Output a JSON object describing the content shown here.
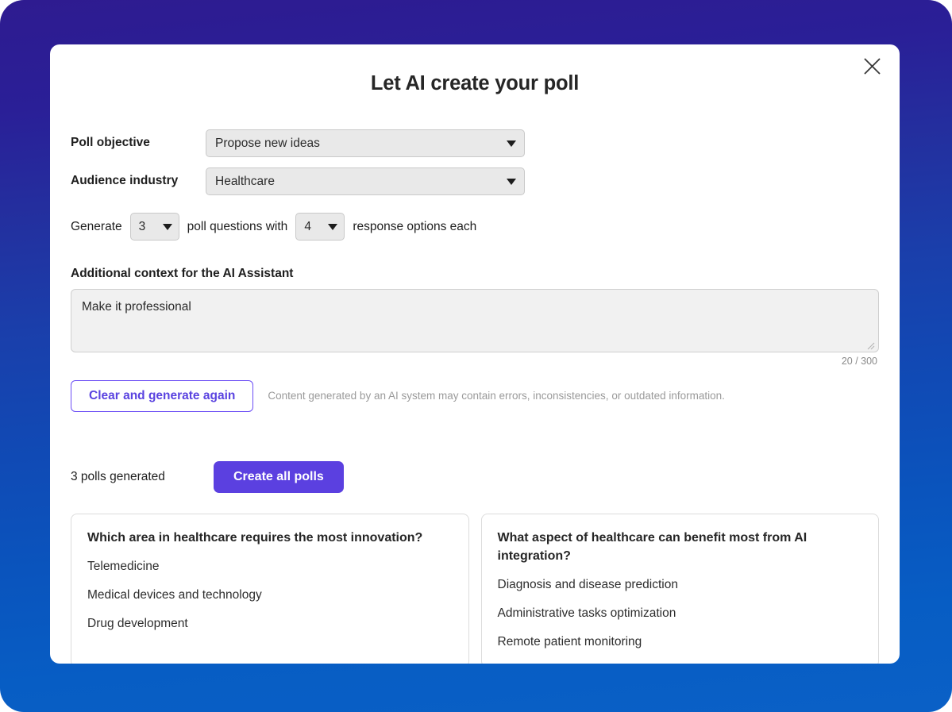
{
  "theme": {
    "gradient_top": "#2e1b90",
    "gradient_bottom": "#0a60c6",
    "accent_primary": "#5b40e0",
    "accent_outline": "#6b4df5",
    "modal_bg": "#ffffff",
    "field_bg": "#e9e9e9",
    "textarea_bg": "#f1f1f1"
  },
  "modal": {
    "title": "Let AI create your poll",
    "close_icon": "close-icon"
  },
  "form": {
    "objective": {
      "label": "Poll objective",
      "value": "Propose new ideas",
      "caret_icon": "chevron-down-icon"
    },
    "industry": {
      "label": "Audience industry",
      "value": "Healthcare",
      "caret_icon": "chevron-down-icon"
    },
    "generate": {
      "prefix": "Generate",
      "questions_count": "3",
      "middle": "poll questions with",
      "options_count": "4",
      "suffix": "response options each"
    },
    "context": {
      "label": "Additional context for the AI Assistant",
      "value": "Make it professional",
      "placeholder": "Additional context for the AI Assistant",
      "char_count": "20 / 300",
      "resize_icon": "resize-grip-icon"
    }
  },
  "actions": {
    "clear_button": "Clear and generate again",
    "disclaimer": "Content generated by an AI system may contain errors, inconsistencies, or outdated information."
  },
  "results": {
    "generated_label": "3 polls generated",
    "create_button": "Create all polls",
    "cards": [
      {
        "question": "Which area in healthcare requires the most innovation?",
        "options": [
          "Telemedicine",
          "Medical devices and technology",
          "Drug development"
        ]
      },
      {
        "question": "What aspect of healthcare can benefit most from AI integration?",
        "options": [
          "Diagnosis and disease prediction",
          "Administrative tasks optimization",
          "Remote patient monitoring"
        ]
      }
    ]
  }
}
